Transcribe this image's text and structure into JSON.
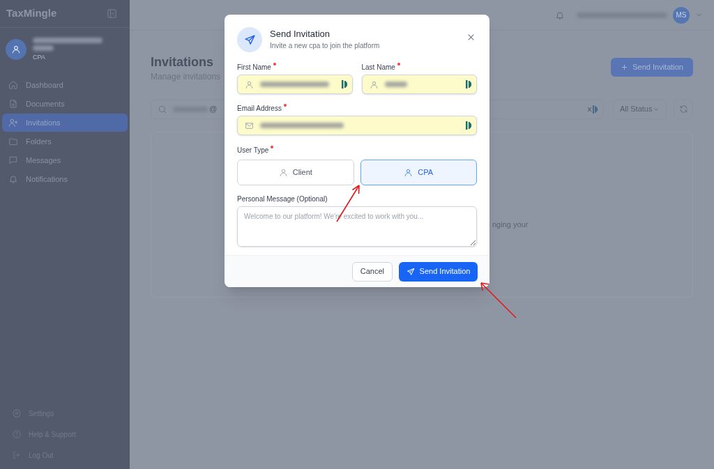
{
  "sidebar": {
    "brand": "TaxMingle",
    "user_role": "CPA",
    "nav": [
      {
        "label": "Dashboard",
        "selected": false
      },
      {
        "label": "Documents",
        "selected": false
      },
      {
        "label": "Invitations",
        "selected": true
      },
      {
        "label": "Folders",
        "selected": false
      },
      {
        "label": "Messages",
        "selected": false
      },
      {
        "label": "Notifications",
        "selected": false
      }
    ],
    "footer_links": [
      {
        "label": "Settings"
      },
      {
        "label": "Help & Support"
      },
      {
        "label": "Log Out"
      }
    ]
  },
  "header": {
    "avatar_initials": "MS"
  },
  "page": {
    "title": "Invitations",
    "subtitle": "Manage invitations",
    "send_button": "Send Invitation",
    "search_value": "@",
    "status_filter": "All Status",
    "empty_text": "nging your"
  },
  "modal": {
    "title": "Send Invitation",
    "subtitle": "Invite a new cpa to join the platform",
    "name_fields": [
      {
        "label": "First Name",
        "required": true
      },
      {
        "label": "Last Name",
        "required": true
      }
    ],
    "email_field": {
      "label": "Email Address",
      "required": true
    },
    "user_type": {
      "label": "User Type",
      "required": true,
      "options": [
        {
          "label": "Client",
          "selected": false
        },
        {
          "label": "CPA",
          "selected": true
        }
      ]
    },
    "message": {
      "label": "Personal Message (Optional)",
      "placeholder": "Welcome to our platform! We're excited to work with you..."
    },
    "cancel_button": "Cancel",
    "submit_button": "Send Invitation"
  }
}
